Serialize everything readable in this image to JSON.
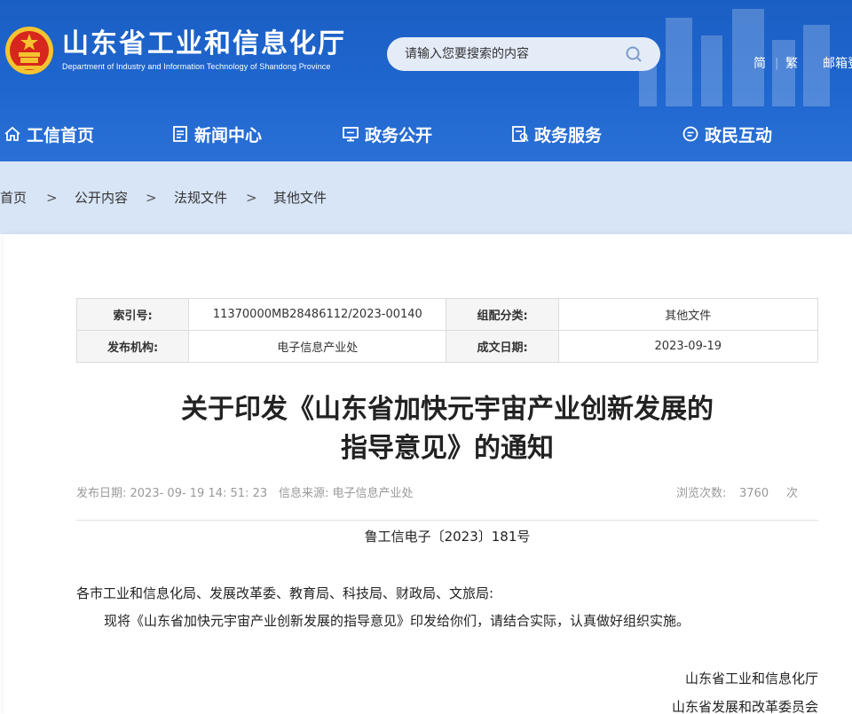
{
  "header": {
    "title": "山东省工业和信息化厅",
    "subtitle": "Department of Industry and Information Technology of Shandong Province",
    "search": {
      "placeholder": "请输入您要搜索的内容"
    },
    "lang": {
      "simplified": "简",
      "separator": "|",
      "traditional": "繁",
      "mailbox": "邮箱登录"
    },
    "colors": {
      "primary": "#1f66cf",
      "band": "#d8e5f7"
    }
  },
  "nav": {
    "items": [
      {
        "label": "工信首页",
        "icon": "home-icon"
      },
      {
        "label": "新闻中心",
        "icon": "news-icon"
      },
      {
        "label": "政务公开",
        "icon": "monitor-icon"
      },
      {
        "label": "政务服务",
        "icon": "service-icon"
      },
      {
        "label": "政民互动",
        "icon": "chat-icon"
      }
    ]
  },
  "breadcrumb": {
    "items": [
      "首页",
      "公开内容",
      "法规文件",
      "其他文件"
    ],
    "separator": ">"
  },
  "meta": {
    "index_label": "索引号:",
    "index_value": "11370000MB28486112/2023-00140",
    "category_label": "组配分类:",
    "category_value": "其他文件",
    "org_label": "发布机构:",
    "org_value": "电子信息产业处",
    "date_label": "成文日期:",
    "date_value": "2023-09-19"
  },
  "article": {
    "title_line1": "关于印发《山东省加快元宇宙产业创新发展的",
    "title_line2": "指导意见》的通知",
    "publish_date": "发布日期: 2023- 09- 19 14: 51: 23",
    "source": "信息来源: 电子信息产业处",
    "views_label": "浏览次数:",
    "views_value": "3760",
    "views_unit": "次",
    "doc_number": "鲁工信电子〔2023〕181号",
    "recipients": "各市工业和信息化局、发展改革委、教育局、科技局、财政局、文旅局:",
    "body": "现将《山东省加快元宇宙产业创新发展的指导意见》印发给你们，请结合实际，认真做好组织实施。",
    "signers": [
      "山东省工业和信息化厅",
      "山东省发展和改革委员会"
    ]
  }
}
